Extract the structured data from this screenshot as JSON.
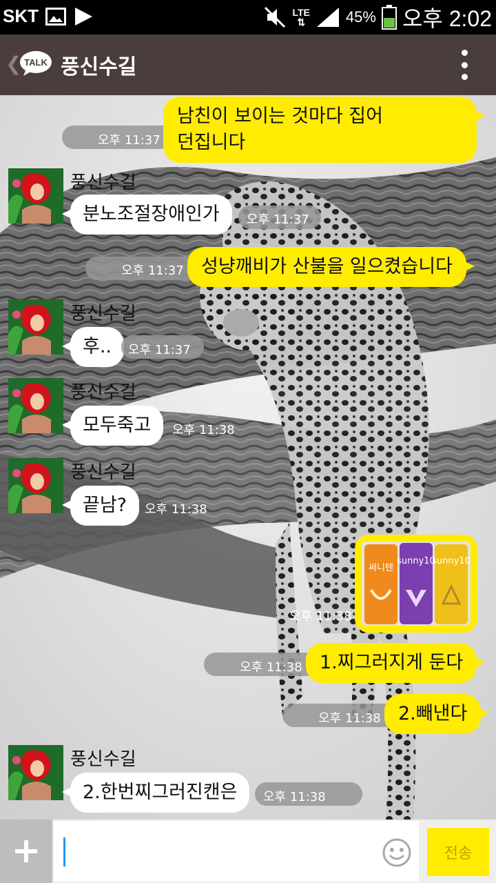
{
  "status_bar": {
    "carrier": "SKT",
    "network": "LTE",
    "battery": "45%",
    "time": "오후 2:02",
    "icons": [
      "image-icon",
      "play-icon",
      "mute-icon",
      "signal-icon",
      "battery-icon"
    ]
  },
  "header": {
    "badge": "TALK",
    "title": "풍신수길"
  },
  "messages": [
    {
      "side": "me",
      "text_lines": [
        "남친이 보이는 것마다 집어",
        "던집니다"
      ],
      "time": "오후 11:37"
    },
    {
      "side": "them",
      "sender": "풍신수길",
      "text": "분노조절장애인가",
      "time": "오후 11:37"
    },
    {
      "side": "me",
      "text": "성냥깨비가 산불을 일으켰습니다",
      "time": "오후 11:37"
    },
    {
      "side": "them",
      "sender": "풍신수길",
      "text": "후..",
      "time": "오후 11:37"
    },
    {
      "side": "them",
      "sender": "풍신수길",
      "text": "모두죽고",
      "time": "오후 11:38"
    },
    {
      "side": "them",
      "sender": "풍신수길",
      "text": "끝남?",
      "time": "오후 11:38"
    },
    {
      "side": "me",
      "type": "image",
      "image_labels": [
        "써니텐",
        "sunny10",
        "sunny10"
      ],
      "time": "오후 11:38"
    },
    {
      "side": "me",
      "text": "1.찌그러지게 둔다",
      "time": "오후 11:38"
    },
    {
      "side": "me",
      "text": "2.빼낸다",
      "time": "오후 11:38"
    },
    {
      "side": "them",
      "sender": "풍신수길",
      "text": "2.한번찌그러진캔은",
      "time": "오후 11:38"
    }
  ],
  "input_bar": {
    "placeholder": "",
    "send_label": "전송"
  },
  "colors": {
    "my_bubble": "#ffec00",
    "their_bubble": "#ffffff",
    "header_bg": "#4a3e3c"
  }
}
